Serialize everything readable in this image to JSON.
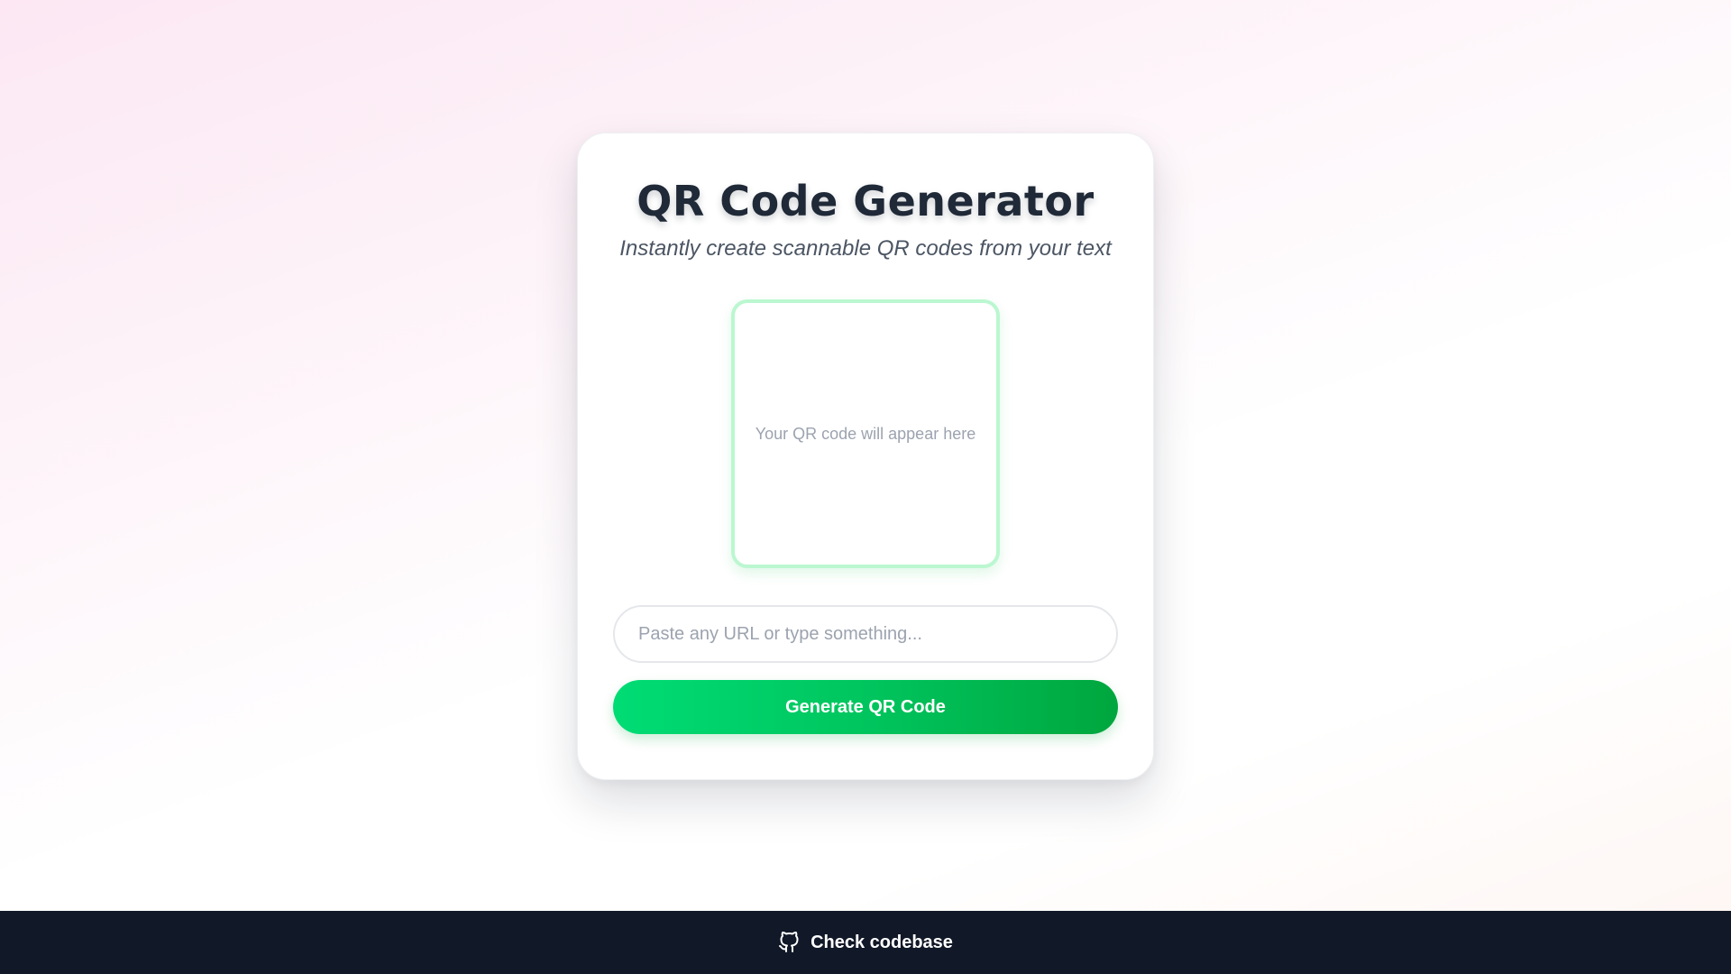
{
  "header": {
    "title": "QR Code Generator",
    "subtitle": "Instantly create scannable QR codes from your text"
  },
  "preview": {
    "placeholder": "Your QR code will appear here"
  },
  "input": {
    "value": "",
    "placeholder": "Paste any URL or type something..."
  },
  "actions": {
    "generate_label": "Generate QR Code"
  },
  "footer": {
    "icon": "github-icon",
    "link_label": "Check codebase"
  },
  "colors": {
    "accent": "#00c55e",
    "preview_border": "#bbf7d0",
    "footer_bg": "#111827",
    "title": "#1f2937"
  }
}
